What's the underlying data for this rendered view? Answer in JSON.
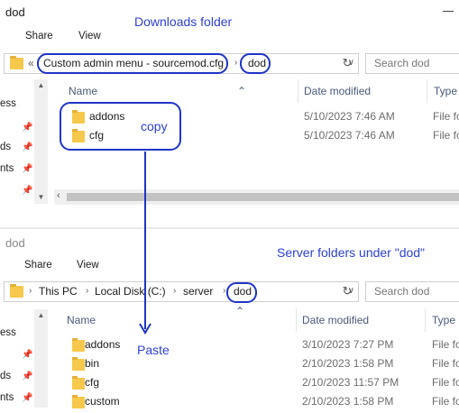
{
  "window1": {
    "title": "dod",
    "ribbon": [
      "Share",
      "View"
    ],
    "breadcrumb": [
      "«",
      "Custom admin menu - sourcemod.cfg",
      "dod"
    ],
    "search_placeholder": "Search dod",
    "nav_items": [
      "ess",
      "ds",
      "nts"
    ],
    "columns": [
      "Name",
      "Date modified",
      "Type"
    ],
    "rows": [
      {
        "name": "addons",
        "date": "5/10/2023 7:46 AM",
        "type": "File fo"
      },
      {
        "name": "cfg",
        "date": "5/10/2023 7:46 AM",
        "type": "File fo"
      }
    ]
  },
  "window2": {
    "title": "dod",
    "ribbon": [
      "Share",
      "View"
    ],
    "breadcrumb": [
      "This PC",
      "Local Disk (C:)",
      "server",
      "dod"
    ],
    "search_placeholder": "Search dod",
    "nav_items": [
      "ess",
      "ds",
      "nts"
    ],
    "columns": [
      "Name",
      "Date modified",
      "Type"
    ],
    "rows": [
      {
        "name": "addons",
        "date": "3/10/2023 7:27 PM",
        "type": "File fo"
      },
      {
        "name": "bin",
        "date": "2/10/2023 1:58 PM",
        "type": "File fo"
      },
      {
        "name": "cfg",
        "date": "2/10/2023 11:57 PM",
        "type": "File fo"
      },
      {
        "name": "custom",
        "date": "2/10/2023 1:58 PM",
        "type": "File fo"
      }
    ]
  },
  "annotations": {
    "downloads": "Downloads folder",
    "copy": "copy",
    "server": "Server folders under \"dod\"",
    "paste": "Paste"
  },
  "colors": {
    "annotation": "#2e40d8",
    "folder": "#f6c84b"
  }
}
